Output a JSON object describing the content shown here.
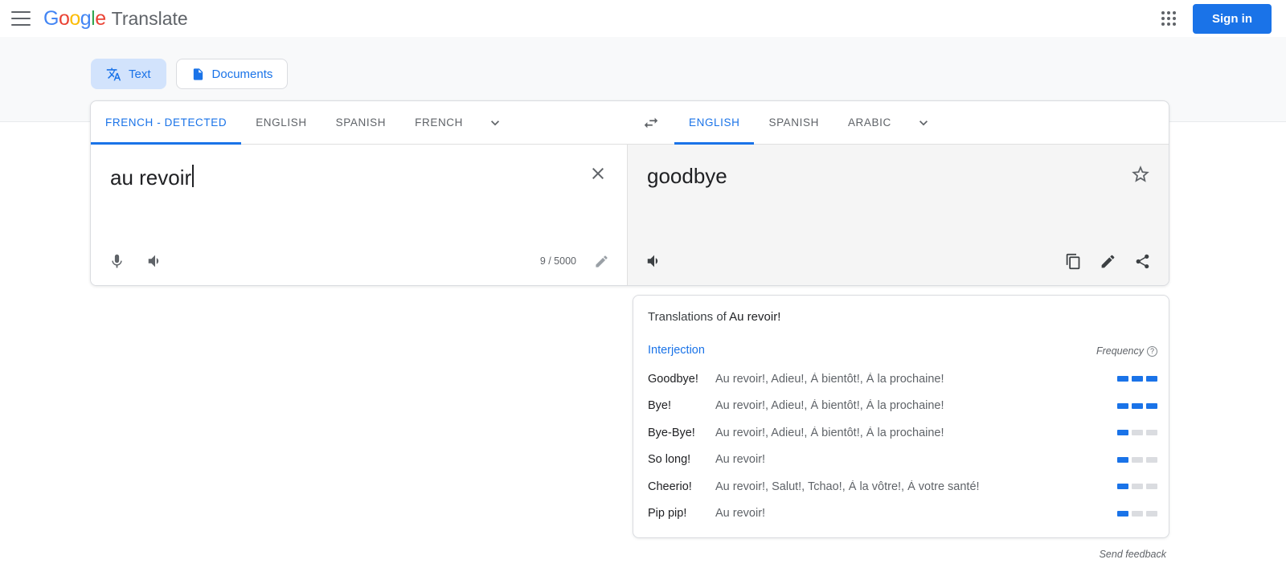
{
  "app": {
    "brand_google": "Google",
    "brand_product": "Translate"
  },
  "topbar": {
    "menu_icon": "hamburger-menu-icon",
    "apps_icon": "google-apps-grid-icon",
    "signin_label": "Sign in"
  },
  "modes": [
    {
      "label": "Text",
      "icon": "translate-text-icon",
      "active": true
    },
    {
      "label": "Documents",
      "icon": "document-icon",
      "active": false
    }
  ],
  "source": {
    "tabs": [
      {
        "label": "FRENCH - DETECTED",
        "selected": true
      },
      {
        "label": "ENGLISH",
        "selected": false
      },
      {
        "label": "SPANISH",
        "selected": false
      },
      {
        "label": "FRENCH",
        "selected": false
      }
    ],
    "more_icon": "chevron-down-icon",
    "text": "au revoir",
    "char_count": "9 / 5000",
    "clear_icon": "close-icon",
    "mic_icon": "microphone-icon",
    "speaker_icon": "speaker-icon",
    "pencil_icon": "handwriting-pencil-icon"
  },
  "swap": {
    "icon": "swap-languages-icon"
  },
  "target": {
    "tabs": [
      {
        "label": "ENGLISH",
        "selected": true
      },
      {
        "label": "SPANISH",
        "selected": false
      },
      {
        "label": "ARABIC",
        "selected": false
      }
    ],
    "more_icon": "chevron-down-icon",
    "text": "goodbye",
    "star_icon": "star-outline-icon",
    "speaker_icon": "speaker-icon",
    "copy_icon": "copy-icon",
    "pencil_icon": "edit-pencil-icon",
    "share_icon": "share-icon"
  },
  "translations": {
    "title_prefix": "Translations of ",
    "title_query": "Au revoir!",
    "part_of_speech": "Interjection",
    "frequency_label": "Frequency",
    "help_icon": "help-question-icon",
    "rows": [
      {
        "term": "Goodbye!",
        "back": "Au revoir!, Adieu!, À bientôt!, À la prochaine!",
        "frequency": 3
      },
      {
        "term": "Bye!",
        "back": "Au revoir!, Adieu!, À bientôt!, À la prochaine!",
        "frequency": 3
      },
      {
        "term": "Bye-Bye!",
        "back": "Au revoir!, Adieu!, À bientôt!, À la prochaine!",
        "frequency": 1
      },
      {
        "term": "So long!",
        "back": "Au revoir!",
        "frequency": 1
      },
      {
        "term": "Cheerio!",
        "back": "Au revoir!, Salut!, Tchao!, À la vôtre!, À votre santé!",
        "frequency": 1
      },
      {
        "term": "Pip pip!",
        "back": "Au revoir!",
        "frequency": 1
      }
    ]
  },
  "footer": {
    "send_feedback": "Send feedback"
  },
  "colors": {
    "accent_blue": "#1a73e8",
    "chip_active_bg": "#d2e3fc",
    "target_pane_bg": "#f5f5f5",
    "strip_bg": "#f8f9fa"
  }
}
